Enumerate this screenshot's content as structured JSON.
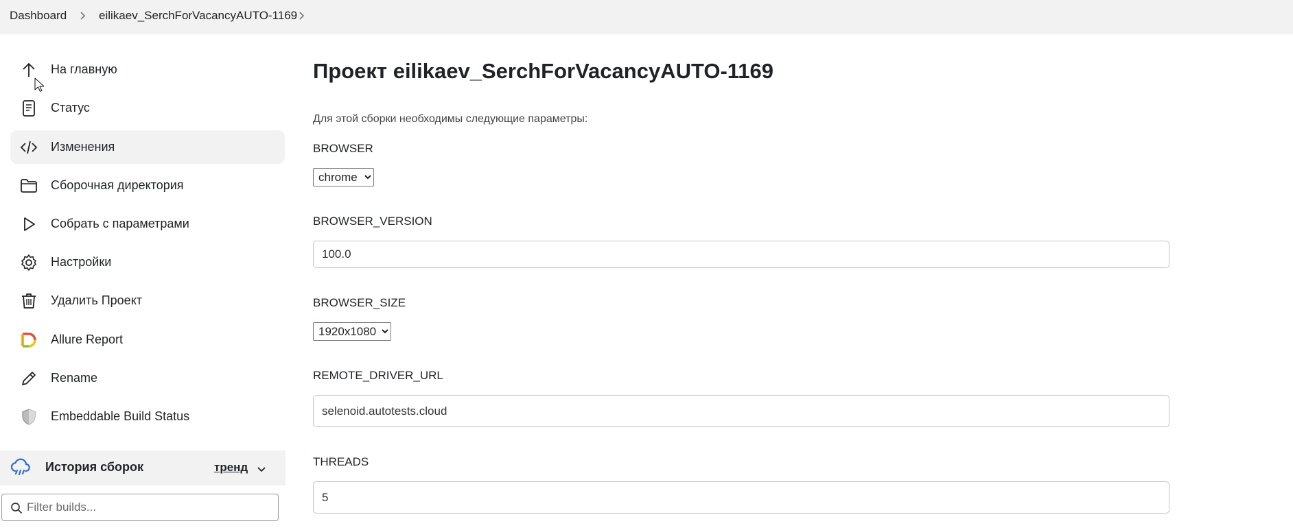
{
  "breadcrumb": {
    "items": [
      "Dashboard",
      "eilikaev_SerchForVacancyAUTO-1169"
    ]
  },
  "sidebar": {
    "items": [
      {
        "label": "На главную",
        "icon": "arrow-up-icon"
      },
      {
        "label": "Статус",
        "icon": "document-icon"
      },
      {
        "label": "Изменения",
        "icon": "code-icon"
      },
      {
        "label": "Сборочная директория",
        "icon": "folder-icon"
      },
      {
        "label": "Собрать с параметрами",
        "icon": "play-icon"
      },
      {
        "label": "Настройки",
        "icon": "gear-icon"
      },
      {
        "label": "Удалить Проект",
        "icon": "trash-icon"
      },
      {
        "label": "Allure Report",
        "icon": "allure-logo-icon"
      },
      {
        "label": "Rename",
        "icon": "pencil-icon"
      },
      {
        "label": "Embeddable Build Status",
        "icon": "shield-icon"
      }
    ],
    "active_item": "Изменения"
  },
  "build_history": {
    "title": "История сборок",
    "trend_label": "тренд",
    "filter_placeholder": "Filter builds..."
  },
  "main": {
    "title": "Проект eilikaev_SerchForVacancyAUTO-1169",
    "intro": "Для этой сборки необходимы следующие параметры:",
    "params": {
      "browser": {
        "label": "BROWSER",
        "value": "chrome"
      },
      "browser_version": {
        "label": "BROWSER_VERSION",
        "value": "100.0"
      },
      "browser_size": {
        "label": "BROWSER_SIZE",
        "value": "1920x1080"
      },
      "remote_driver_url": {
        "label": "REMOTE_DRIVER_URL",
        "value": "selenoid.autotests.cloud"
      },
      "threads": {
        "label": "THREADS",
        "value": "5"
      }
    }
  },
  "colors": {
    "topbar_bg": "#f2f2f3",
    "active_item_bg": "#f2f2f3",
    "history_icon": "#2a6fd6",
    "text": "#1f2328"
  }
}
